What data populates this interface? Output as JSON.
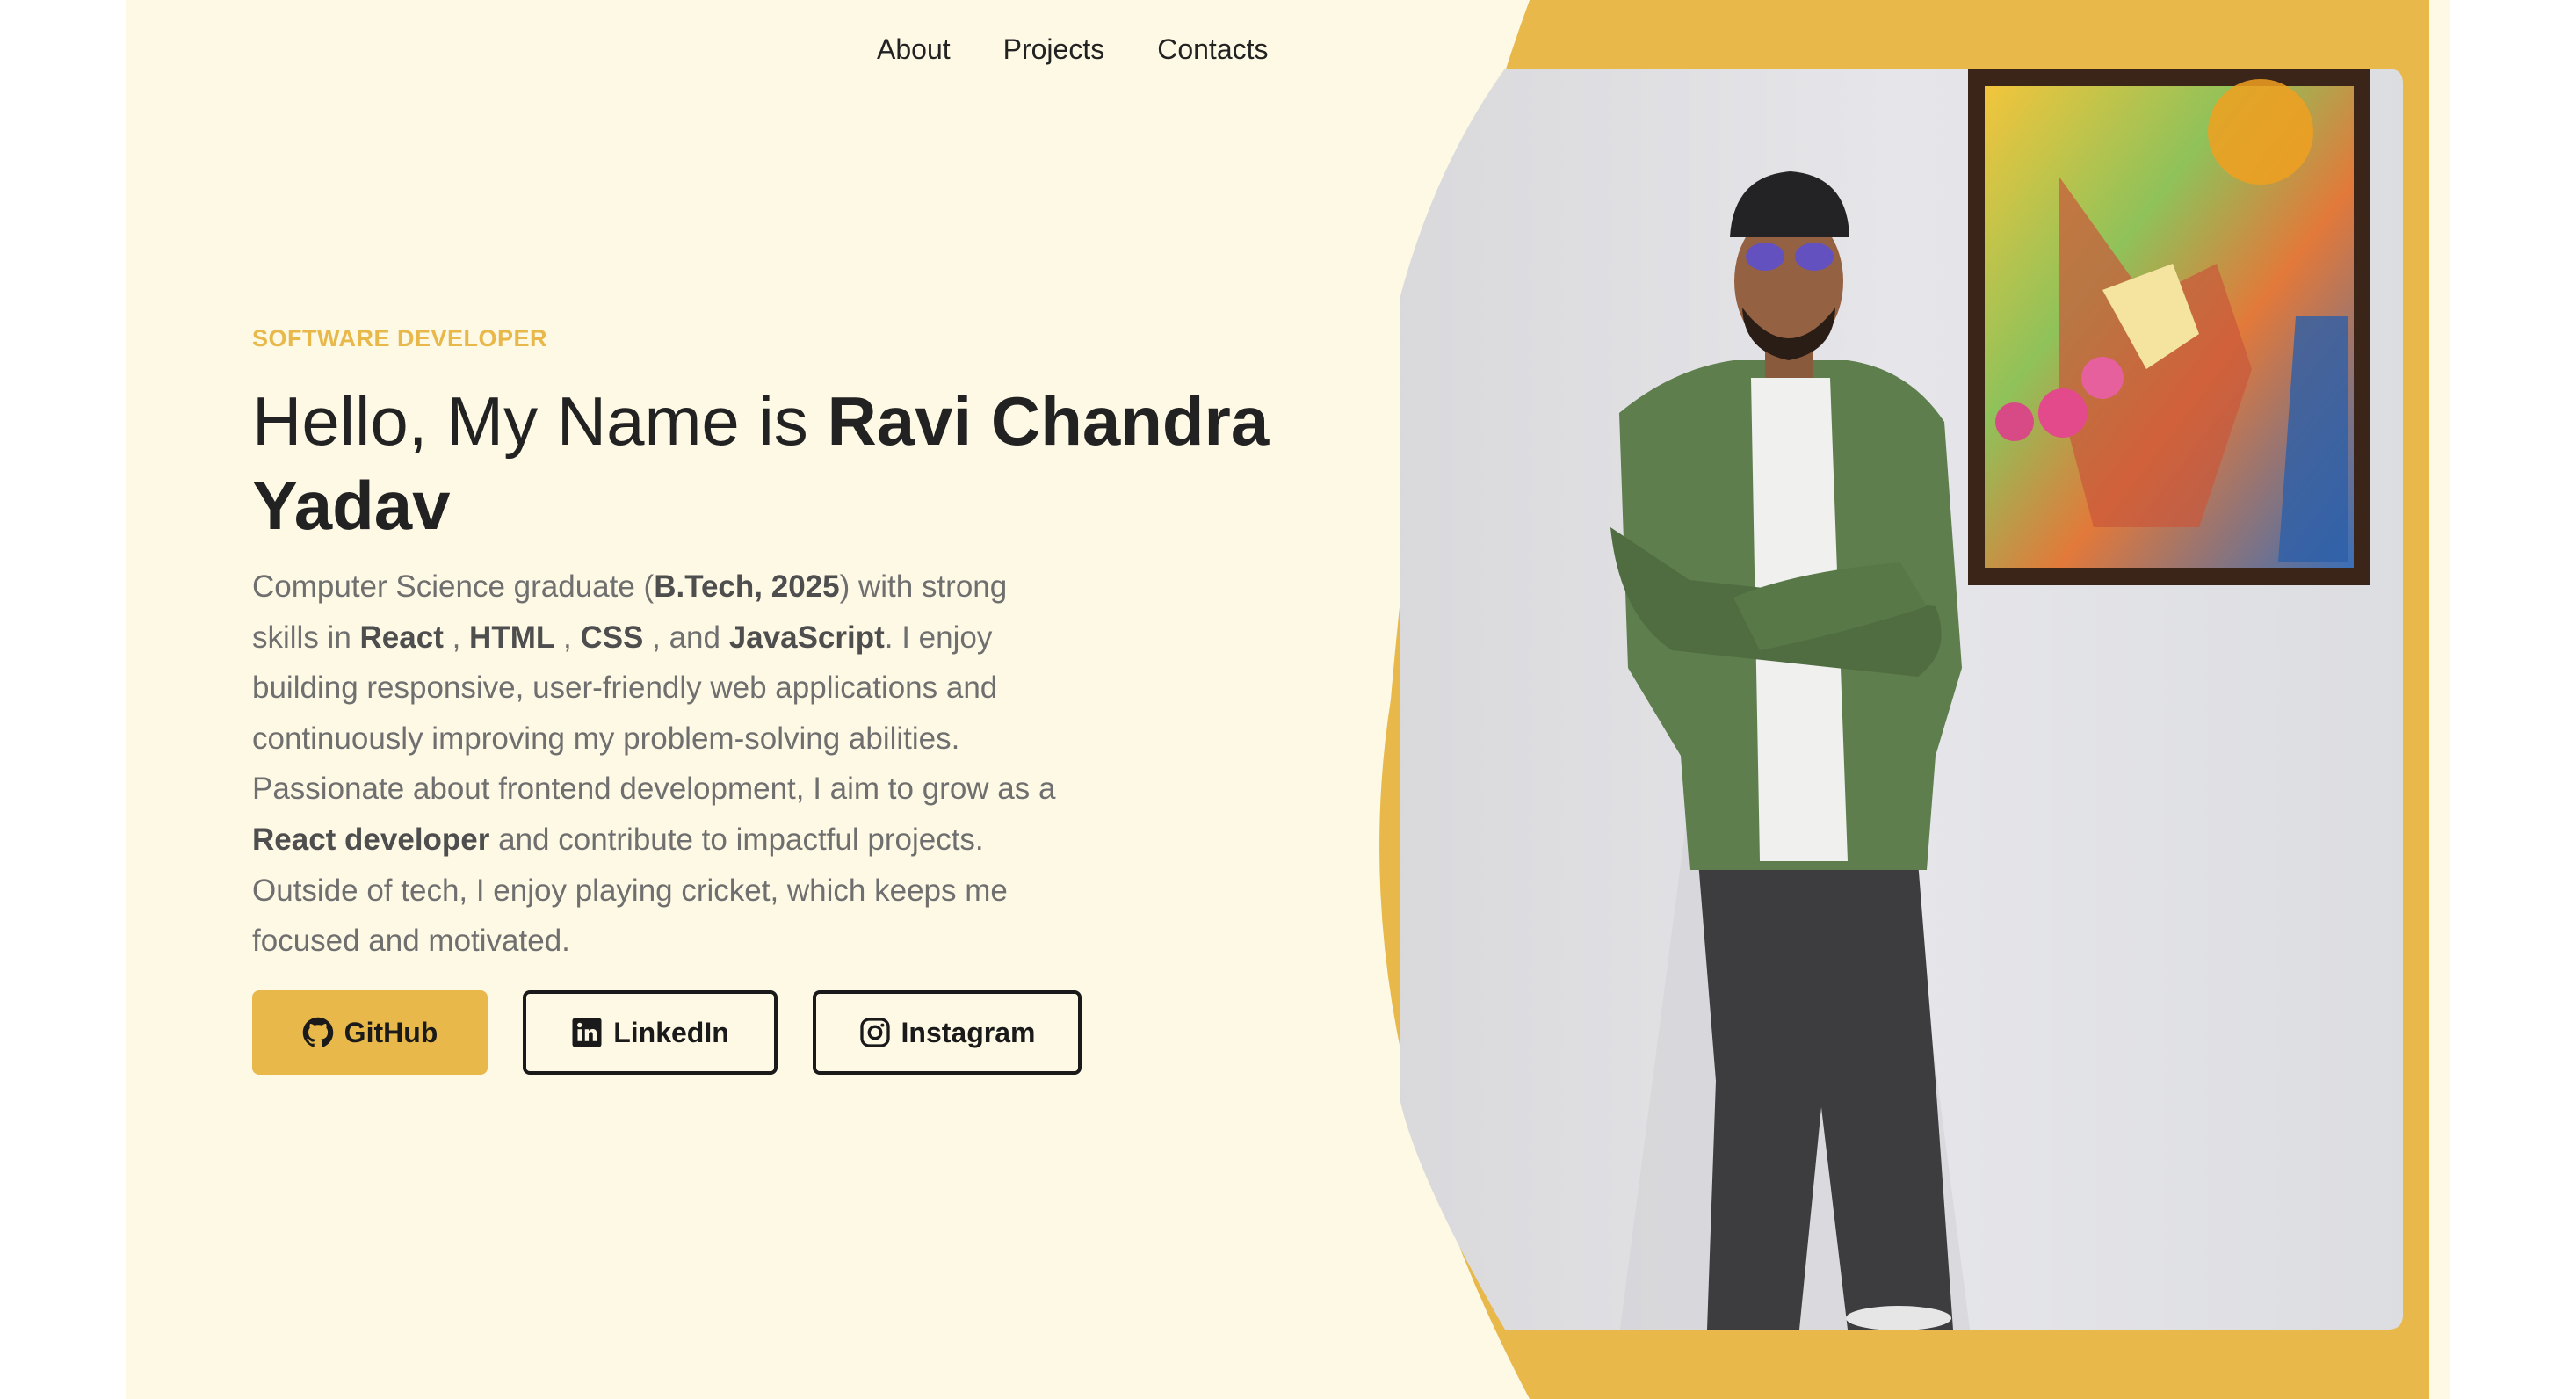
{
  "nav": {
    "items": [
      {
        "label": "About"
      },
      {
        "label": "Projects"
      },
      {
        "label": "Contacts"
      }
    ]
  },
  "hero": {
    "eyebrow": "SOFTWARE DEVELOPER",
    "greeting": "Hello, My Name is ",
    "name": "Ravi Chandra Yadav",
    "bio": {
      "p1": "Computer Science graduate (",
      "degree": "B.Tech, 2025",
      "p2": ") with strong skills in ",
      "skill1": "React",
      "sep1": " , ",
      "skill2": "HTML",
      "sep2": " , ",
      "skill3": "CSS",
      "sep3": " , and ",
      "skill4": "JavaScript",
      "p3": ". I enjoy building responsive, user-friendly web applications and continuously improving my problem-solving abilities. Passionate about frontend development, I aim to grow as a ",
      "role": "React developer",
      "p4": " and contribute to impactful projects. Outside of tech, I enjoy playing cricket, which keeps me focused and motivated."
    }
  },
  "buttons": {
    "github": {
      "label": "GitHub",
      "icon": "github-icon"
    },
    "linkedin": {
      "label": "LinkedIn",
      "icon": "linkedin-icon"
    },
    "instagram": {
      "label": "Instagram",
      "icon": "instagram-icon"
    }
  },
  "colors": {
    "background": "#fdf9e5",
    "accent": "#e8b84a",
    "text": "#222222",
    "muted": "#6f6f6f"
  }
}
